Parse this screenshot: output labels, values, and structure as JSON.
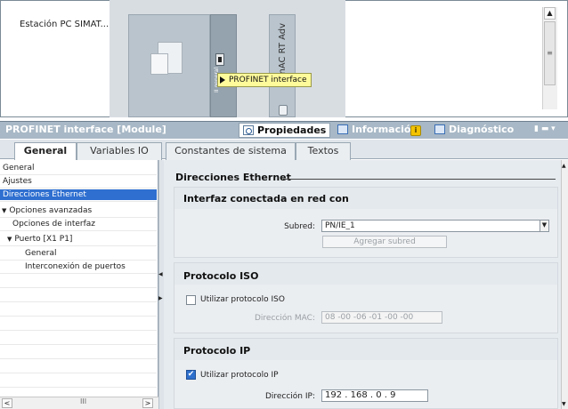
{
  "top_view": {
    "station_label": "Estación PC SIMAT...",
    "slot_text": "II general",
    "cpu_label": "WinAC RT Adv",
    "tooltip": "PROFINET interface"
  },
  "header": {
    "title": "PROFINET interface [Module]",
    "tabs": [
      {
        "label": "Propiedades",
        "active": true
      },
      {
        "label": "Información"
      },
      {
        "label": "Diagnóstico"
      }
    ],
    "info_badge": "i",
    "window_controls": "▮ ▬ ▾"
  },
  "subtabs": [
    "General",
    "Variables IO",
    "Constantes de sistema",
    "Textos"
  ],
  "nav": {
    "items": [
      {
        "label": "General",
        "indent": 0
      },
      {
        "label": "Ajustes",
        "indent": 0
      },
      {
        "label": "Direcciones Ethernet",
        "indent": 0,
        "selected": true
      },
      {
        "label": "Opciones avanzadas",
        "indent": 0,
        "expanded": true
      },
      {
        "label": "Opciones de interfaz",
        "indent": 1
      },
      {
        "label": "Puerto [X1 P1]",
        "indent": 1,
        "expanded": true
      },
      {
        "label": "General",
        "indent": 2
      },
      {
        "label": "Interconexión de puertos",
        "indent": 2
      }
    ],
    "scroll_grip": "III"
  },
  "content": {
    "section_title": "Direcciones Ethernet",
    "interface": {
      "title": "Interfaz conectada en red con",
      "subnet_label": "Subred:",
      "subnet_value": "PN/IE_1",
      "add_subnet_button": "Agregar subred"
    },
    "iso": {
      "title": "Protocolo ISO",
      "use_iso_label": "Utilizar protocolo ISO",
      "mac_label": "Dirección MAC:",
      "mac_value": "08 -00 -06 -01 -00 -00"
    },
    "ip": {
      "title": "Protocolo IP",
      "use_ip_label": "Utilizar protocolo IP",
      "ip_label": "Dirección IP:",
      "ip_value": "192  . 168  . 0      . 9"
    }
  },
  "colors": {
    "header_bar": "#a8b8c6",
    "nav_selected": "#2f6fd0",
    "tooltip_bg": "#fffb9b"
  }
}
